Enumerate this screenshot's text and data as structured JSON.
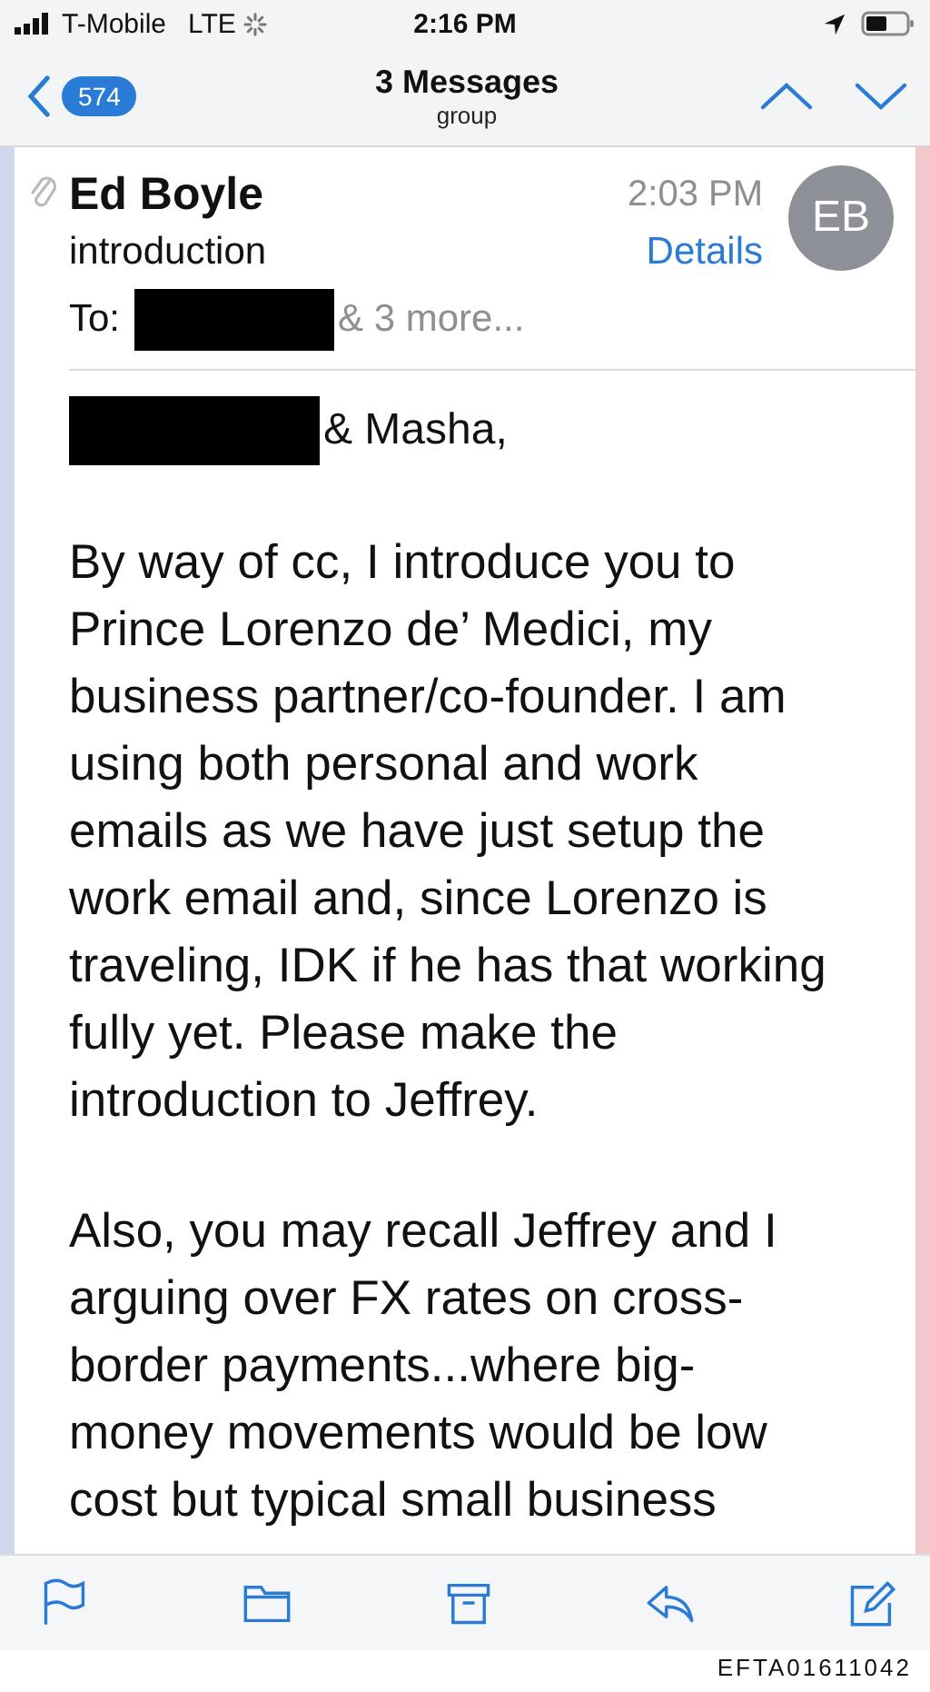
{
  "status_bar": {
    "carrier": "T-Mobile",
    "network": "LTE",
    "time": "2:16 PM"
  },
  "nav": {
    "badge": "574",
    "title": "3 Messages",
    "subtitle": "group"
  },
  "message": {
    "sender": "Ed Boyle",
    "time": "2:03 PM",
    "avatar": "EB",
    "subject": "introduction",
    "details_link": "Details",
    "to_label": "To:",
    "to_more": "& 3 more...",
    "greeting": "& Masha,",
    "paragraphs": [
      {
        "lines": [
          "By way of cc, I introduce you to",
          "Prince Lorenzo de’ Medici, my",
          "business partner/co-founder. I am",
          "using both personal and work",
          "emails as we have just setup the",
          "work email and, since Lorenzo is",
          "traveling, IDK if he has that working",
          "fully yet. Please make the",
          "introduction to Jeffrey."
        ]
      },
      {
        "lines": [
          "Also, you may recall Jeffrey and I",
          "arguing over FX rates on cross-",
          "border payments...where big-",
          "money movements would be low",
          "cost but typical small business"
        ]
      }
    ]
  },
  "toolbar": [
    {
      "kind": "flag"
    },
    {
      "kind": "folder"
    },
    {
      "kind": "archive"
    },
    {
      "kind": "reply"
    },
    {
      "kind": "compose"
    }
  ],
  "footer_label": "EFTA01611042"
}
